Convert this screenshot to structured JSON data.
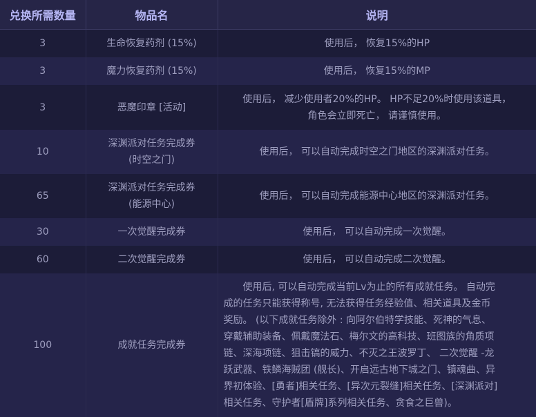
{
  "header": {
    "col_qty": "兑换所需数量",
    "col_item": "物品名",
    "col_desc": "说明"
  },
  "rows": [
    {
      "qty": "3",
      "item": "生命恢复药剂 (15%)",
      "desc": "使用后， 恢复15%的HP"
    },
    {
      "qty": "3",
      "item": "魔力恢复药剂 (15%)",
      "desc": "使用后， 恢复15%的MP"
    },
    {
      "qty": "3",
      "item": "恶魔印章 [活动]",
      "desc_lines": [
        "使用后， 减少使用者20%的HP。 HP不足20%时使用该道具，",
        "角色会立即死亡， 请谨慎使用。"
      ]
    },
    {
      "qty": "10",
      "item_lines": [
        "深渊派对任务完成券",
        "(时空之门)"
      ],
      "desc": "使用后， 可以自动完成时空之门地区的深渊派对任务。"
    },
    {
      "qty": "65",
      "item_lines": [
        "深渊派对任务完成券",
        "(能源中心)"
      ],
      "desc": "使用后， 可以自动完成能源中心地区的深渊派对任务。"
    },
    {
      "qty": "30",
      "item": "一次觉醒完成券",
      "desc": "使用后， 可以自动完成一次觉醒。"
    },
    {
      "qty": "60",
      "item": "二次觉醒完成券",
      "desc": "使用后， 可以自动完成二次觉醒。"
    },
    {
      "qty": "100",
      "item": "成就任务完成券",
      "desc_lines": [
        "使用后, 可以自动完成当前Lv为止的所有成就任务。 自动完",
        "成的任务只能获得称号, 无法获得任务经验值、相关道具及金币",
        "奖励。 (以下成就任务除外 : 向阿尔伯特学技能、死神的气息、",
        "穿戴辅助装备、佩戴魔法石、梅尔文的高科技、班图族的角质项",
        "链、深海项链、狙击镐的威力、不灭之王波罗丁、 二次觉醒 -龙",
        "跃武器、铁鳞海贼团 (舰长)、开启远古地下城之门、镇魂曲、异",
        "界初体验、[勇者]相关任务、[异次元裂缝]相关任务、[深渊派对]",
        "相关任务、守护者[盾牌]系列相关任务、贪食之巨兽)。"
      ]
    }
  ]
}
